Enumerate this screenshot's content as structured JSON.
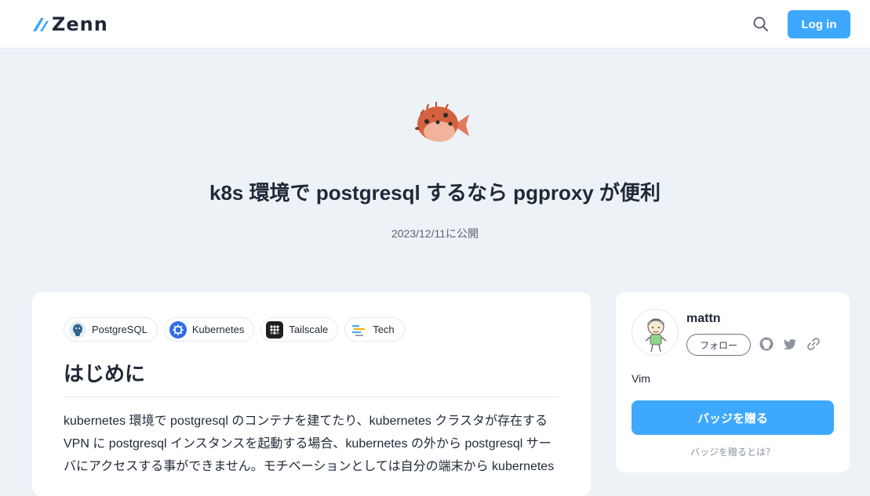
{
  "header": {
    "logo_text": "Zenn",
    "search_icon": "search-icon",
    "login_label": "Log in",
    "accent_color": "#3ea8ff"
  },
  "article": {
    "emoji": "blowfish-emoji",
    "title": "k8s 環境で postgresql するなら pgproxy が便利",
    "published": "2023/12/11に公開",
    "topics": [
      {
        "label": "PostgreSQL",
        "icon": "postgresql-icon"
      },
      {
        "label": "Kubernetes",
        "icon": "kubernetes-icon"
      },
      {
        "label": "Tailscale",
        "icon": "tailscale-icon"
      },
      {
        "label": "Tech",
        "icon": "tech-icon"
      }
    ],
    "heading": "はじめに",
    "paragraph_lines": [
      "kubernetes 環境で postgresql のコンテナを建てたり、kubernetes クラスタが存在する",
      "VPN に postgresql インスタンスを起動する場合、kubernetes の外から postgresql サー",
      "バにアクセスする事ができません。モチベーションとしては自分の端末から kubernetes"
    ]
  },
  "author": {
    "name": "mattn",
    "follow_label": "フォロー",
    "social_icons": [
      "github-icon",
      "twitter-icon",
      "link-icon"
    ],
    "bio": "Vim",
    "badge_button": "バッジを贈る",
    "badge_help": "バッジを贈るとは？"
  }
}
